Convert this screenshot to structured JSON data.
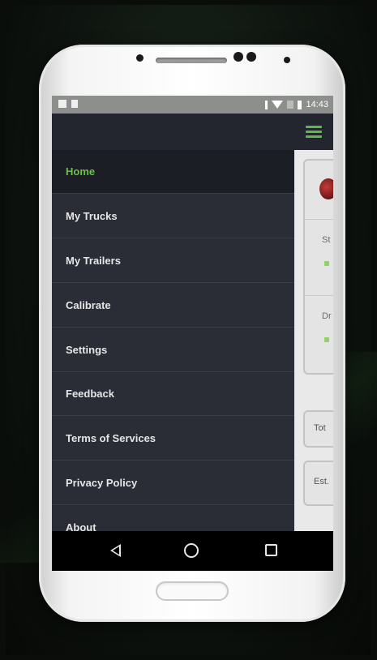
{
  "status_bar": {
    "time": "14:43"
  },
  "drawer": {
    "items": [
      {
        "label": "Home",
        "active": true
      },
      {
        "label": "My Trucks",
        "active": false
      },
      {
        "label": "My Trailers",
        "active": false
      },
      {
        "label": "Calibrate",
        "active": false
      },
      {
        "label": "Settings",
        "active": false
      },
      {
        "label": "Feedback",
        "active": false
      },
      {
        "label": "Terms of Services",
        "active": false
      },
      {
        "label": "Privacy Policy",
        "active": false
      },
      {
        "label": "About",
        "active": false
      }
    ]
  },
  "content_peek": {
    "label_st": "St",
    "label_dr": "Dr",
    "label_tot": "Tot",
    "label_est": "Est."
  },
  "colors": {
    "accent": "#6cc04a",
    "drawer_bg": "#2a2d35",
    "appbar_bg": "#23262e"
  },
  "icons": {
    "menu": "hamburger-icon",
    "back": "back-triangle-icon",
    "home": "home-circle-icon",
    "recent": "recent-apps-icon"
  }
}
